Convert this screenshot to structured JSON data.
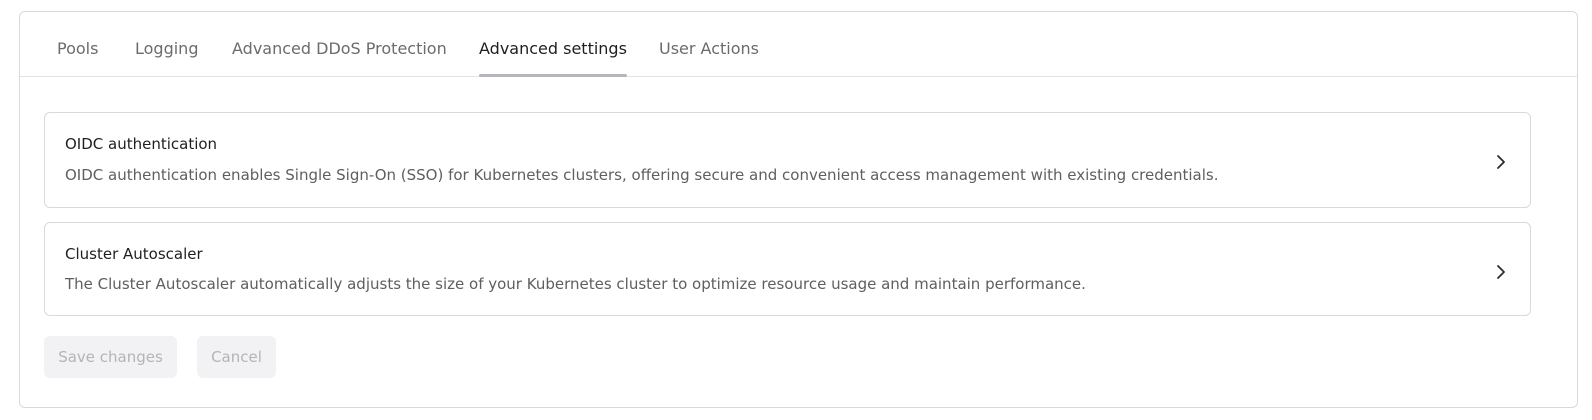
{
  "tabs": [
    {
      "label": "Pools",
      "active": false
    },
    {
      "label": "Logging",
      "active": false
    },
    {
      "label": "Advanced DDoS Protection",
      "active": false
    },
    {
      "label": "Advanced settings",
      "active": true
    },
    {
      "label": "User Actions",
      "active": false
    }
  ],
  "cards": [
    {
      "title": "OIDC authentication",
      "description": "OIDC authentication enables Single Sign-On (SSO) for Kubernetes clusters, offering secure and convenient access management with existing credentials.",
      "icon": "chevron-right-icon"
    },
    {
      "title": "Cluster Autoscaler",
      "description": "The Cluster Autoscaler automatically adjusts the size of your Kubernetes cluster to optimize resource usage and maintain performance.",
      "icon": "chevron-right-icon"
    }
  ],
  "actions": {
    "save_label": "Save changes",
    "cancel_label": "Cancel"
  },
  "colors": {
    "border": "#d9d9dc",
    "active_tab_underline": "#b5b5ba",
    "disabled_button_bg": "#f2f2f4",
    "disabled_button_text": "#b4b4b9"
  }
}
